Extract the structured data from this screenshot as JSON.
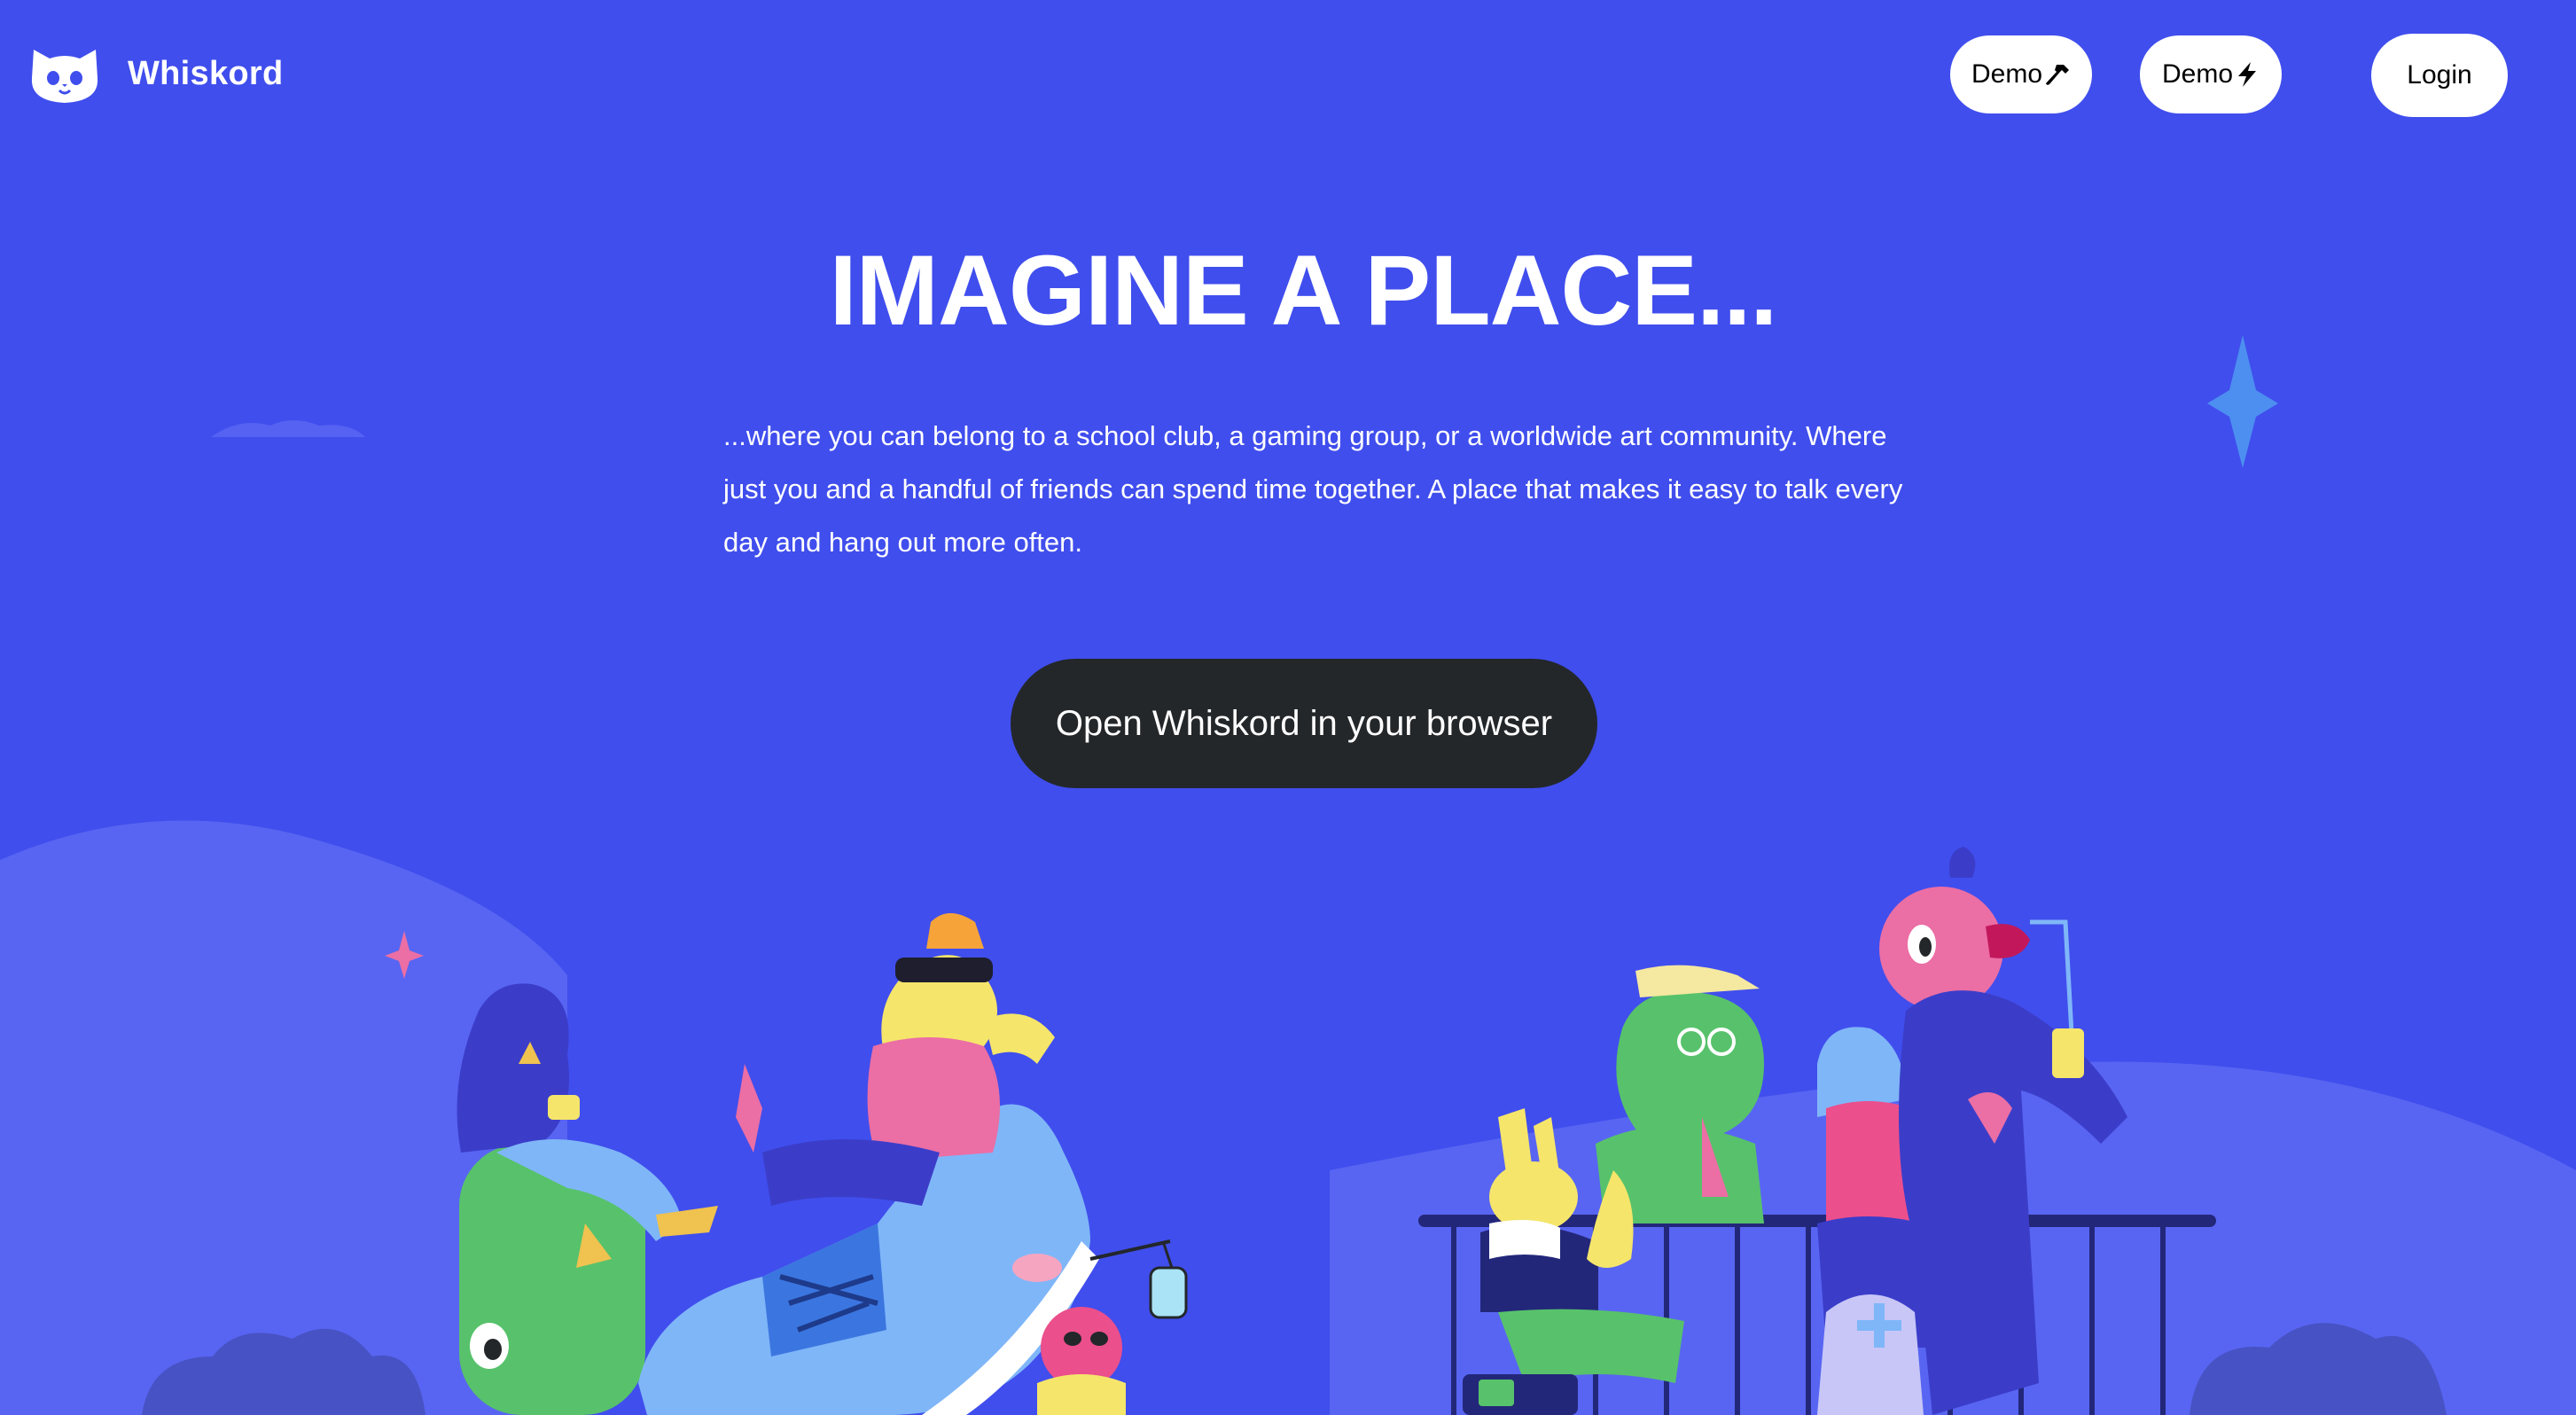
{
  "app": {
    "name": "Whiskord"
  },
  "header": {
    "logo_text": "Whiskord",
    "logo_icon": "cat-face-icon",
    "buttons": [
      {
        "label": "Demo",
        "icon": "hammer-icon"
      },
      {
        "label": "Demo",
        "icon": "lightning-bolt-icon"
      },
      {
        "label": "Login"
      }
    ]
  },
  "hero": {
    "title": "IMAGINE A PLACE...",
    "description": "...where you can belong to a school club, a gaming group, or a worldwide art community. Where just you and a handful of friends can spend time together. A place that makes it easy to talk every day and hang out more often.",
    "cta_label": "Open Whiskord in your browser"
  },
  "colors": {
    "background": "#404EED",
    "cta_background": "#23272A",
    "button_background": "#FFFFFF",
    "hill": "#5865F2",
    "sparkle": "#4C8FF0"
  }
}
